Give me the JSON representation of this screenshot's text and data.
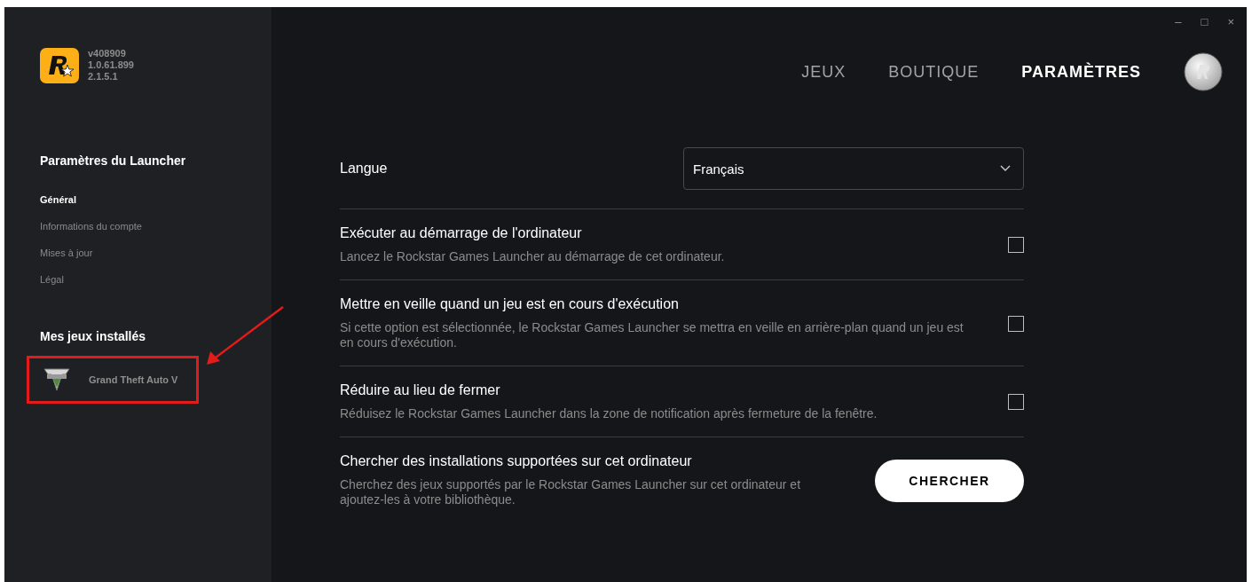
{
  "versions": [
    "v408909",
    "1.0.61.899",
    "2.1.5.1"
  ],
  "window_controls": [
    "–",
    "□",
    "×"
  ],
  "nav": [
    {
      "label": "JEUX",
      "selected": false
    },
    {
      "label": "BOUTIQUE",
      "selected": false
    },
    {
      "label": "PARAMÈTRES",
      "selected": true
    }
  ],
  "sidebar": {
    "title": "Paramètres du Launcher",
    "items": [
      {
        "label": "Général",
        "selected": true
      },
      {
        "label": "Informations du compte",
        "selected": false
      },
      {
        "label": "Mises à jour",
        "selected": false
      },
      {
        "label": "Légal",
        "selected": false
      }
    ],
    "games_title": "Mes jeux installés",
    "games": [
      {
        "label": "Grand Theft Auto V",
        "highlighted": true
      }
    ]
  },
  "settings": [
    {
      "kind": "select",
      "label": "Langue",
      "value": "Français"
    },
    {
      "kind": "checkbox",
      "label": "Exécuter au démarrage de l'ordinateur",
      "description": "Lancez le Rockstar Games Launcher au démarrage de cet ordinateur.",
      "checked": false
    },
    {
      "kind": "checkbox",
      "label": "Mettre en veille quand un jeu est en cours d'exécution",
      "description": "Si cette option est sélectionnée, le Rockstar Games Launcher se mettra en veille en arrière-plan quand un jeu est en cours d'exécution.",
      "checked": false
    },
    {
      "kind": "checkbox",
      "label": "Réduire au lieu de fermer",
      "description": "Réduisez le Rockstar Games Launcher dans la zone de notification après fermeture de la fenêtre.",
      "checked": false
    },
    {
      "kind": "button",
      "label": "Chercher des installations supportées sur cet ordinateur",
      "description": "Cherchez des jeux supportés par le Rockstar Games Launcher sur cet ordinateur et ajoutez-les à votre bibliothèque.",
      "button": "CHERCHER"
    }
  ]
}
